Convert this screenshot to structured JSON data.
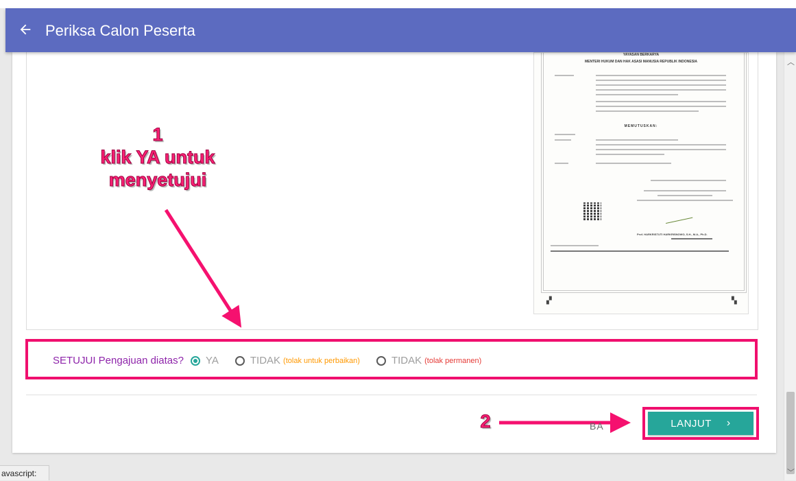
{
  "appbar": {
    "title": "Periksa Calon Peserta"
  },
  "document_image": {
    "header_org": "YAYASAN BERKARYA",
    "header_ministry": "MENTERI HUKUM DAN HAK ASASI MANUSIA REPUBLIK INDONESIA",
    "memutuskan": "MEMUTUSKAN:",
    "signatory": "Prof. HARKRISTUTI HARKRISNOWO, S.H., M.A., Ph.D."
  },
  "annotations": {
    "step1_number": "1",
    "step1_line1": "klik YA untuk",
    "step1_line2": "menyetujui",
    "step2_number": "2"
  },
  "approval": {
    "question": "SETUJUI Pengajuan diatas?",
    "options": [
      {
        "label": "YA",
        "hint": "",
        "selected": true
      },
      {
        "label": "TIDAK",
        "hint": "(tolak untuk perbaikan)",
        "selected": false
      },
      {
        "label": "TIDAK",
        "hint": "(tolak permanen)",
        "selected": false
      }
    ]
  },
  "footer": {
    "back_label": "BA",
    "next_label": "LANJUT"
  },
  "statusbar": {
    "text": "avascript:"
  },
  "colors": {
    "appbar": "#5c6bc0",
    "accent": "#26a69a",
    "annotation": "#fb2276",
    "question": "#8e24aa"
  }
}
